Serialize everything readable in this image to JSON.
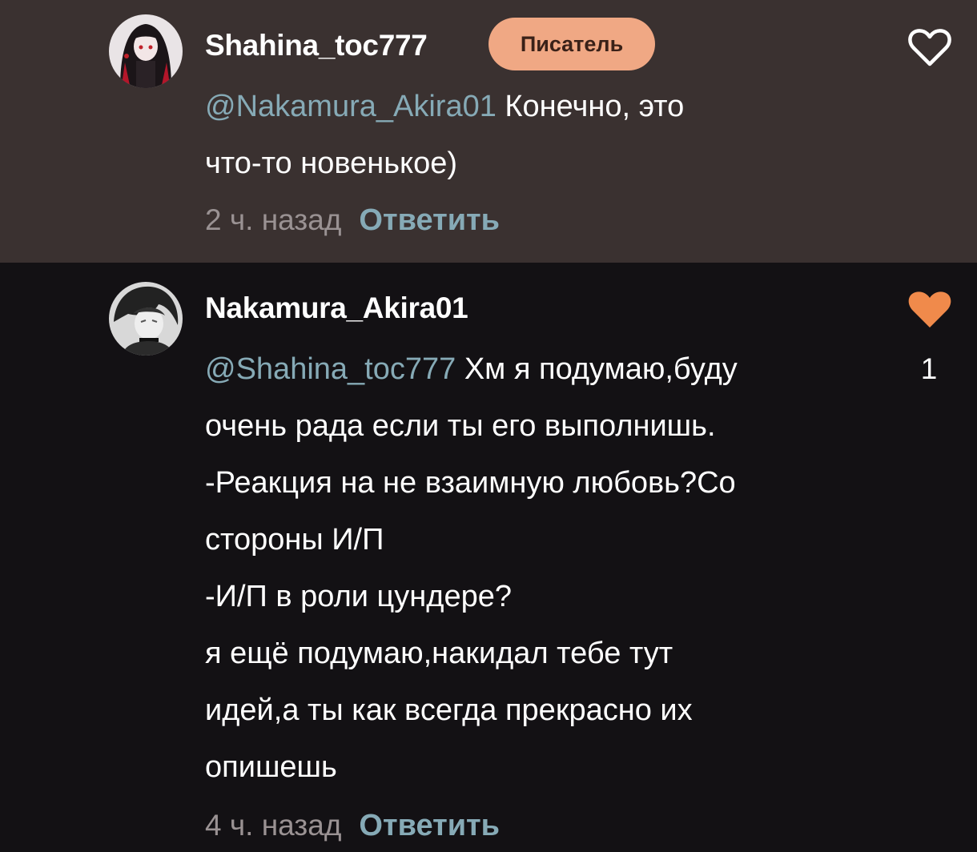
{
  "comments": [
    {
      "username": "Shahina_toc777",
      "badge": "Писатель",
      "mention": "@Nakamura_Akira01",
      "text_lines": [
        "Конечно, это",
        "что-то новенькое)"
      ],
      "time": "2 ч. назад",
      "reply_label": "Ответить",
      "liked": false,
      "like_icon": "heart-outline-icon"
    },
    {
      "username": "Nakamura_Akira01",
      "mention": "@Shahina_toc777",
      "text_lines": [
        "Хм я подумаю,буду",
        "очень рада если ты его выполнишь.",
        "-Реакция на не взаимную любовь?Со",
        "стороны И/П",
        "-И/П в роли цундере?",
        "я ещё подумаю,накидал тебе тут",
        "идей,а ты как всегда прекрасно их",
        "опишешь"
      ],
      "time": "4 ч. назад",
      "reply_label": "Ответить",
      "liked": true,
      "like_icon": "heart-filled-icon",
      "like_count": "1"
    }
  ],
  "colors": {
    "highlight_bg": "#3a3130",
    "page_bg": "#131114",
    "accent": "#86aab6",
    "badge_bg": "#f0a884",
    "like": "#f08a4b"
  }
}
